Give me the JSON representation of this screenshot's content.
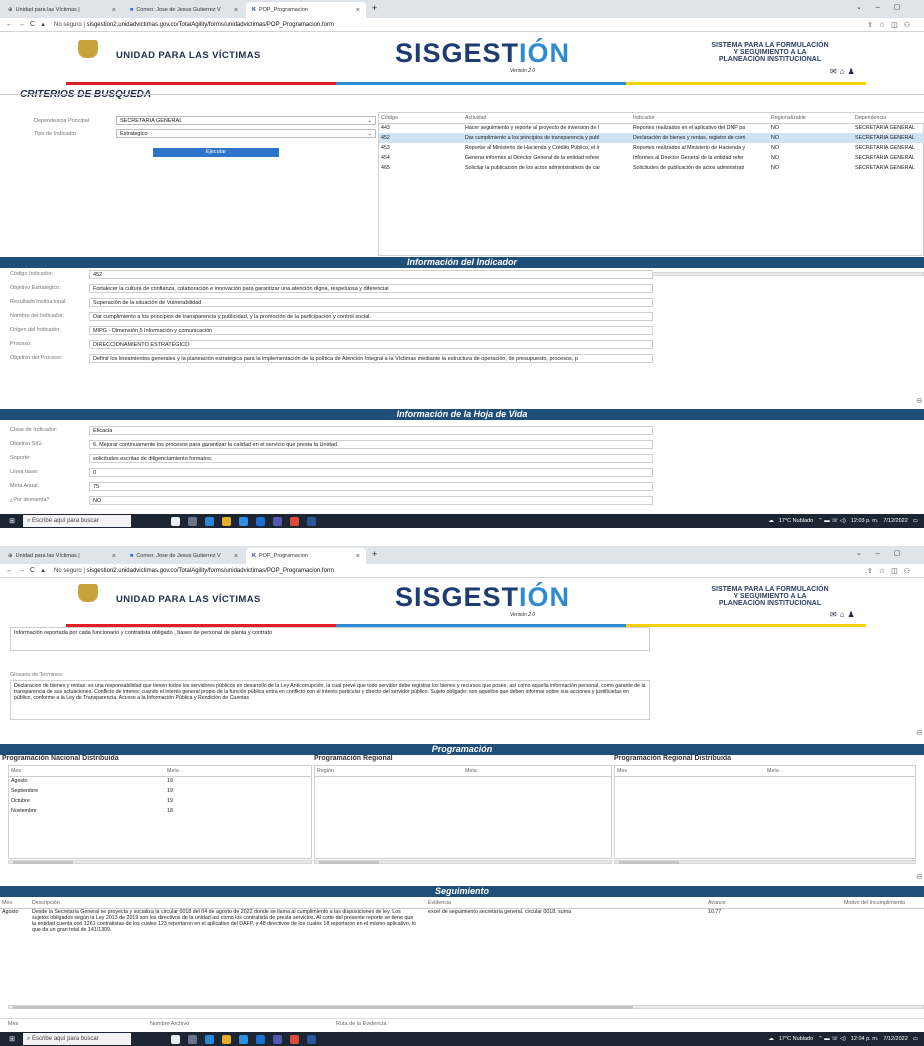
{
  "browser": {
    "tabs": [
      "Unidad para las Víctimas |",
      "Correo: Jose de Jesus Gutierrez V",
      "POP_Programacion"
    ],
    "address_prefix": "No seguro",
    "address_url": "sisgestion2.unidadvictimas.gov.co/TotalAgility/forms/unidadvictimas/POP_Programacion.form",
    "new_tab": "+"
  },
  "header": {
    "org": "UNIDAD PARA LAS VÍCTIMAS",
    "brand_a": "SISGEST",
    "brand_b": "IÓN",
    "version": "Versión 2.0",
    "system_line1": "SISTEMA PARA LA FORMULACIÓN",
    "system_line2": "Y SEGUIMIENTO A LA",
    "system_line3": "PLANEACIÓN INSTITUCIONAL",
    "colors": {
      "red": "#e31e24",
      "blue": "#2f8bd0",
      "yellow": "#f6d200",
      "navy": "#1f4e79"
    }
  },
  "criteria": {
    "title": "CRITERIOS DE BUSQUEDA",
    "dep_label": "Dependencia Principal",
    "dep_value": "SECRETARIA GENERAL",
    "tipo_label": "Tipo de Indicador",
    "tipo_value": "Estrategico",
    "run_button": "Ejecutar"
  },
  "results": {
    "headers": [
      "Código",
      "Actividad",
      "Indicador",
      "Regionalizable",
      "Dependencia"
    ],
    "rows": [
      [
        "443",
        "Hacer seguimiento y reporte al proyecto de inversion de l",
        "Reportes realizados en el aplicativo del DNP pa",
        "NO",
        "SECRETARIA GENERAL"
      ],
      [
        "452",
        "Dar cumplimiento a los principios de transparencia y publ",
        "Declaración de bienes y rentas, registro de corri",
        "NO",
        "SECRETARIA GENERAL"
      ],
      [
        "453",
        "Reportar al Ministerio de Hacienda y Crédito Público, el ir",
        "Reportes realizados al Ministerio de Hacienda y",
        "NO",
        "SECRETARIA GENERAL"
      ],
      [
        "454",
        "Generar informes al Director General de la entidad refere",
        "Informes al Director General de la entidad refer",
        "NO",
        "SECRETARIA GENERAL"
      ],
      [
        "465",
        "Solicitar la publicación de los actos administrativos de car",
        "Solicitudes de publicación de actos administrati",
        "NO",
        "SECRETARIA GENERAL"
      ]
    ]
  },
  "indicator_info": {
    "title": "Información del Indicador",
    "fields": [
      {
        "label": "Código Indicador:",
        "value": "452"
      },
      {
        "label": "Objetivo Estratégico:",
        "value": "Fortalecer la cultura de confianza, colaboración e innovación para garantizar una atención digna, respetuosa y diferencial"
      },
      {
        "label": "Resultado Institucional:",
        "value": "Superación de la situación de Vulnerabilidad"
      },
      {
        "label": "Nombre del Indicador:",
        "value": "Dar cumplimiento a los principios de transparencia y publicidad, y la promoción de la participación y control social."
      },
      {
        "label": "Origen del Indicador",
        "value": "MIPG - Dimensión 5 Información y comunicación"
      },
      {
        "label": "Proceso:",
        "value": "DIRECCIONAMIENTO ESTRATEGICO"
      },
      {
        "label": "Objetivo del Proceso:",
        "value": "Definir los lineamientos generales y la planeación estratégica para la implementación de la política de Atención Integral a la Víctimas mediante la estructura de operación, de presupuesto, procesos, p"
      }
    ]
  },
  "hoja_vida": {
    "title": "Información de la Hoja de Vida",
    "fields": [
      {
        "label": "Clase de Indicador:",
        "value": "Eficacia"
      },
      {
        "label": "Objetivo SIG:",
        "value": "6. Mejorar continuamente los procesos para garantizar la calidad en el servicio que presta la Unidad."
      },
      {
        "label": "Soporte:",
        "value": "solicitudes escritas de diligenciamiento formatos;"
      },
      {
        "label": "Linea base:",
        "value": "0"
      },
      {
        "label": "Meta Anual:",
        "value": "75"
      },
      {
        "label": "¿Por demanda?",
        "value": "NO"
      }
    ]
  },
  "taskbar": {
    "search": "Escribe aquí para buscar",
    "weather": "17°C  Nublado",
    "time1": "12:03 p. m.",
    "date": "7/12/2022",
    "time2": "12:04 p. m."
  },
  "lower": {
    "info_text": "Información reportada por cada funcionario y contratista obligado , bases de personal de planta y contrato",
    "glosario_label": "Glosario de Terminos:",
    "glosario_text": "Declaracion de bienes y rentas: es una responsabilidad que tienen todos los servidores públicos en desarrollo de la Ley Anticorrupción, la cual prevé que todo servidor debe registrar los bienes y recursos que posee, así como aquella información personal, como garante de la transparencia de sus actuaciones. Conflicto de interes: cuando el interés general propio de la función pública entra en conflicto con el interés particular y directo del servidor público. Sujeto obligado: son aquellos que deben informar sobre sus acciones y justificarlas en público, conforme a la Ley de Transparencia. Acceso a la Información Pública y Rendición de Cuentas",
    "prog_title": "Programación",
    "nacional_title": "Programación Nacional Distribuida",
    "regional_title": "Programación Regional",
    "regdist_title": "Programación Regional Distribuida",
    "col_mes": "Mes",
    "col_meta": "Meta",
    "col_region": "Región",
    "nacional_rows": [
      [
        "Agosto",
        "19"
      ],
      [
        "Septiembre",
        "19"
      ],
      [
        "Octubre",
        "19"
      ],
      [
        "Noviembre",
        "18"
      ]
    ],
    "seg_title": "Seguimiento",
    "seg_headers": [
      "Mes",
      "Descripción",
      "Evidencia",
      "Avance",
      "Motivo del Incumplimiento"
    ],
    "seg_row": {
      "mes": "Agosto",
      "descripcion": "Desde la Secretaría General se proyecta y socializa la circular 0018 del 04 de agosto de 2022 donde se llama al cumplimiento a las disposiciones de ley. Los sujetos obligados según la Ley 2013 de 2019 son los directivos de la unidad así como los contratista de presta servicios. Al corte del presente reporte se tiene que la entidad cuenta con 1261 contratistas de los cuales 123 reportaron en el aplicativo del DAFP, y 48 directivos de los cuales 18 reportaron en el mismo aplicativo, lo que da un gran total de 141/1309.",
      "evidencia": "excel de seguimiento secretaría general, circular 0018, suma",
      "avance": "10.77"
    },
    "bottom_headers": [
      "Mes",
      "Nombre Archivo",
      "Ruta de la Evidencia"
    ]
  }
}
